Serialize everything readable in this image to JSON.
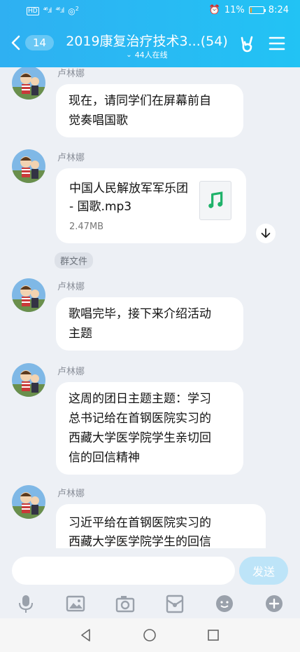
{
  "status": {
    "left_icons": [
      "hd-icon",
      "signal-4g-icon",
      "signal-4g-icon",
      "hotspot-icon"
    ],
    "sig1": "⁴⁶.ıl",
    "sig2": "⁴⁶.ıl",
    "hotspot_count": "2",
    "battery_percent": "11%",
    "battery_level": 0.11,
    "time": "8:24"
  },
  "header": {
    "unread_count": "14",
    "title": "2019康复治疗技术3...(54)",
    "online": "44人在线"
  },
  "messages": [
    {
      "sender": "卢林娜",
      "text": "现在，请同学们在屏幕前自\n觉奏唱国歌"
    },
    {
      "sender": "卢林娜",
      "file": {
        "name": "中国人民解放军军乐团 - 国歌.mp3",
        "size": "2.47MB"
      }
    },
    {
      "sender": "卢林娜",
      "text": "歌唱完毕，接下来介绍活动\n主题"
    },
    {
      "sender": "卢林娜",
      "text": "这周的团日主题主题：学习\n总书记给在首钢医院实习的\n西藏大学医学院学生亲切回\n信的回信精神"
    },
    {
      "sender": "卢林娜",
      "text": "习近平给在首钢医院实习的\n西藏大学医学院学生的回信"
    }
  ],
  "file_tag": "群文件",
  "composer": {
    "placeholder": "",
    "send_label": "发送"
  },
  "colors": {
    "header_start": "#2fb0f2",
    "header_end": "#22c3f4",
    "chat_bg": "#edf0f5",
    "send_disabled": "#bde4f8",
    "music_green": "#1fb26a"
  }
}
